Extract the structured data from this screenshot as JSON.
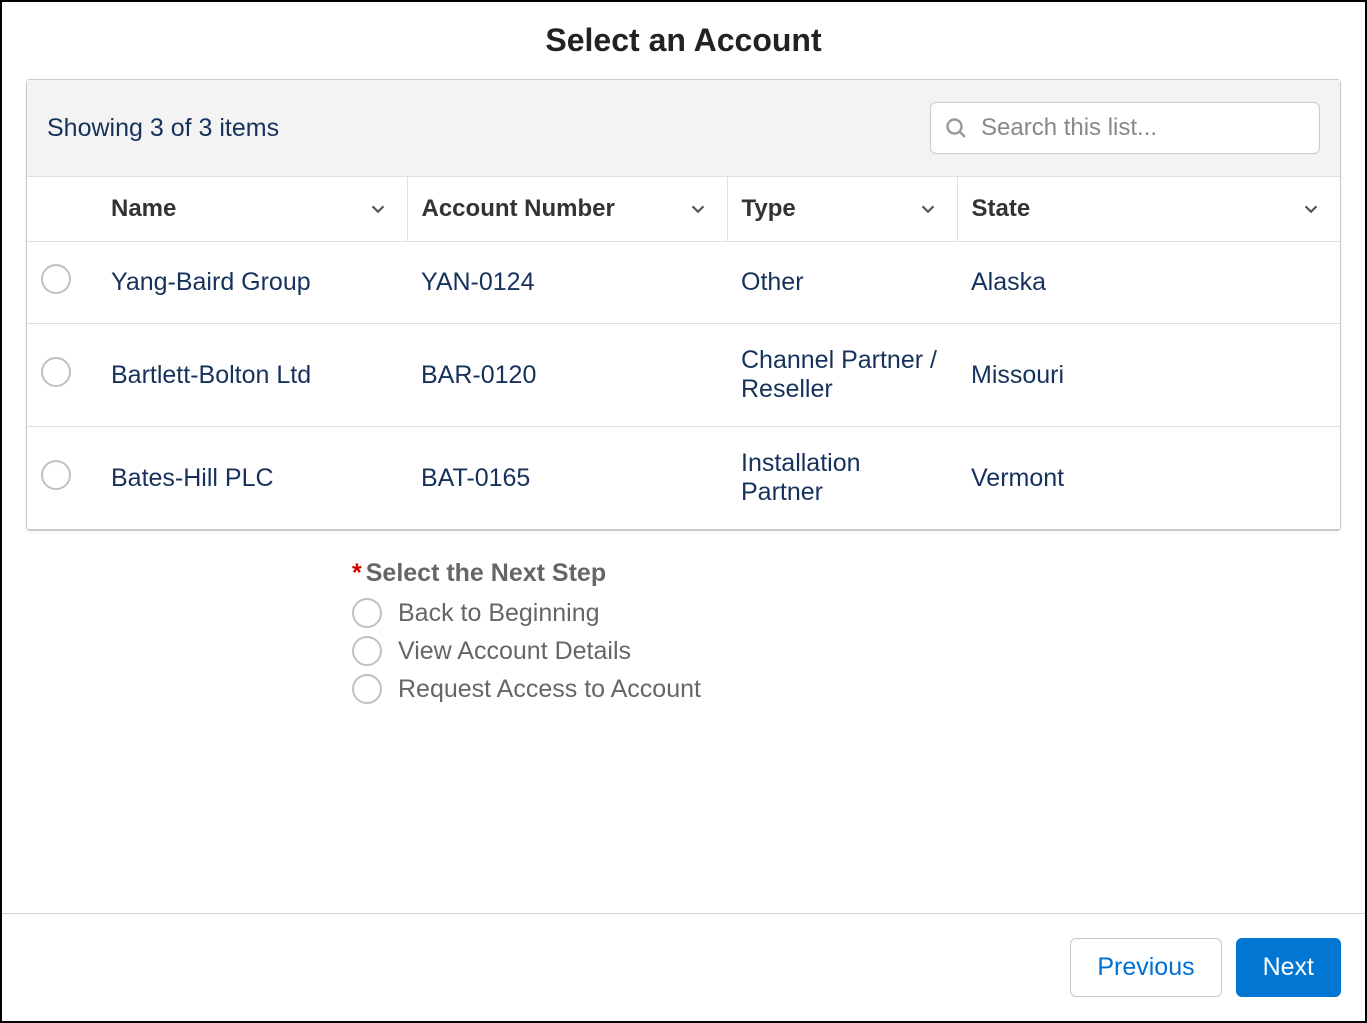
{
  "title": "Select an Account",
  "list": {
    "showing_text": "Showing 3 of 3 items",
    "search_placeholder": "Search this list...",
    "columns": {
      "name": "Name",
      "account_number": "Account Number",
      "type": "Type",
      "state": "State"
    },
    "rows": [
      {
        "name": "Yang-Baird Group",
        "account_number": "YAN-0124",
        "type": "Other",
        "state": "Alaska"
      },
      {
        "name": "Bartlett-Bolton Ltd",
        "account_number": "BAR-0120",
        "type": "Channel Partner / Reseller",
        "state": "Missouri"
      },
      {
        "name": "Bates-Hill PLC",
        "account_number": "BAT-0165",
        "type": "Installation Partner",
        "state": "Vermont"
      }
    ]
  },
  "next_step": {
    "label": "Select the Next Step",
    "required_marker": "*",
    "options": [
      "Back to Beginning",
      "View Account Details",
      "Request Access to Account"
    ]
  },
  "footer": {
    "previous": "Previous",
    "next": "Next"
  }
}
